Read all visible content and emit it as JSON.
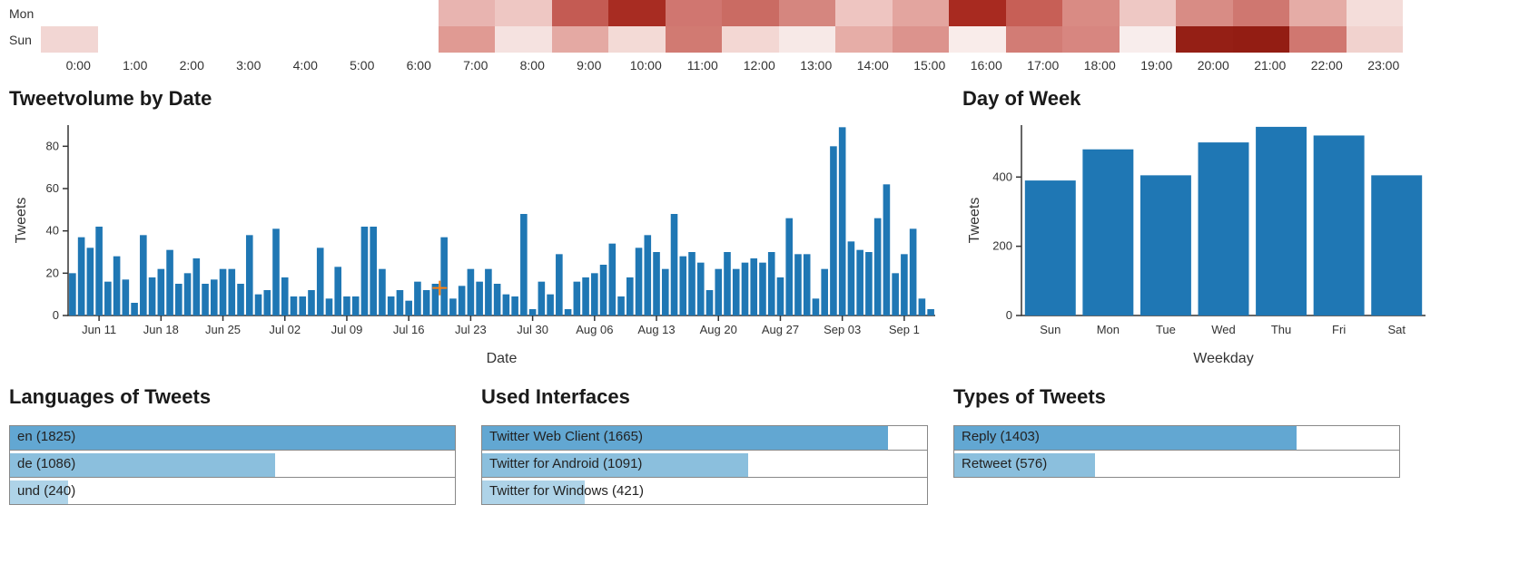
{
  "chart_data": [
    {
      "type": "heatmap",
      "rows": [
        "Mon",
        "Sun"
      ],
      "cols": [
        "0:00",
        "1:00",
        "2:00",
        "3:00",
        "4:00",
        "5:00",
        "6:00",
        "7:00",
        "8:00",
        "9:00",
        "10:00",
        "11:00",
        "12:00",
        "13:00",
        "14:00",
        "15:00",
        "16:00",
        "17:00",
        "18:00",
        "19:00",
        "20:00",
        "21:00",
        "22:00",
        "23:00"
      ],
      "colors": [
        [
          "#ffffff",
          "#ffffff",
          "#ffffff",
          "#ffffff",
          "#ffffff",
          "#ffffff",
          "#ffffff",
          "#e8b4b0",
          "#eec7c3",
          "#c45b53",
          "#a82c22",
          "#d07670",
          "#ca6b63",
          "#d5867f",
          "#eec5c1",
          "#e3a59f",
          "#a82a20",
          "#c75f56",
          "#d98b84",
          "#eec8c4",
          "#d88c85",
          "#cf7770",
          "#e5aca6",
          "#f4ddda"
        ],
        [
          "#f2d6d3",
          "#ffffff",
          "#ffffff",
          "#ffffff",
          "#ffffff",
          "#ffffff",
          "#ffffff",
          "#e09a93",
          "#f5e2e0",
          "#e4a9a3",
          "#f3dad6",
          "#d17a72",
          "#f3d7d3",
          "#f7e9e7",
          "#e6ada7",
          "#dc938d",
          "#f9ecea",
          "#d27c75",
          "#d78680",
          "#f8edec",
          "#951f15",
          "#931d13",
          "#d07770",
          "#f1d2ce"
        ]
      ]
    },
    {
      "type": "bar",
      "title": "Tweetvolume by Date",
      "xlabel": "Date",
      "ylabel": "Tweets",
      "ylim": [
        0,
        90
      ],
      "yticks": [
        0,
        20,
        40,
        60,
        80
      ],
      "xticks": [
        "Jun 11",
        "Jun 18",
        "Jun 25",
        "Jul 02",
        "Jul 09",
        "Jul 16",
        "Jul 23",
        "Jul 30",
        "Aug 06",
        "Aug 13",
        "Aug 20",
        "Aug 27",
        "Sep 03",
        "Sep 1"
      ],
      "values": [
        20,
        37,
        32,
        42,
        16,
        28,
        17,
        6,
        38,
        18,
        22,
        31,
        15,
        20,
        27,
        15,
        17,
        22,
        22,
        15,
        38,
        10,
        12,
        41,
        18,
        9,
        9,
        12,
        32,
        8,
        23,
        9,
        9,
        42,
        42,
        22,
        9,
        12,
        7,
        16,
        12,
        15,
        37,
        8,
        14,
        22,
        16,
        22,
        15,
        10,
        9,
        48,
        3,
        16,
        10,
        29,
        3,
        16,
        18,
        20,
        24,
        34,
        9,
        18,
        32,
        38,
        30,
        22,
        48,
        28,
        30,
        25,
        12,
        22,
        30,
        22,
        25,
        27,
        25,
        30,
        18,
        46,
        29,
        29,
        8,
        22,
        80,
        89,
        35,
        31,
        30,
        46,
        62,
        20,
        29,
        41,
        8,
        3
      ]
    },
    {
      "type": "bar",
      "title": "Day of Week",
      "xlabel": "Weekday",
      "ylabel": "Tweets",
      "ylim": [
        0,
        550
      ],
      "yticks": [
        0,
        200,
        400
      ],
      "categories": [
        "Sun",
        "Mon",
        "Tue",
        "Wed",
        "Thu",
        "Fri",
        "Sat"
      ],
      "values": [
        390,
        480,
        405,
        500,
        545,
        520,
        405
      ]
    },
    {
      "type": "bar_h",
      "title": "Languages of Tweets",
      "max": 1825,
      "items": [
        {
          "label": "en",
          "value": 1825
        },
        {
          "label": "de",
          "value": 1086
        },
        {
          "label": "und",
          "value": 240
        }
      ]
    },
    {
      "type": "bar_h",
      "title": "Used Interfaces",
      "max": 1825,
      "items": [
        {
          "label": "Twitter Web Client",
          "value": 1665
        },
        {
          "label": "Twitter for Android",
          "value": 1091
        },
        {
          "label": "Twitter for Windows",
          "value": 421
        }
      ]
    },
    {
      "type": "bar_h",
      "title": "Types of Tweets",
      "max": 1825,
      "items": [
        {
          "label": "Reply",
          "value": 1403
        },
        {
          "label": "Retweet",
          "value": 576
        }
      ]
    }
  ],
  "colors": {
    "bar": "#1f77b4",
    "bar_alt1": "#5ea3d0",
    "bar_alt2": "#a3cbe5"
  }
}
